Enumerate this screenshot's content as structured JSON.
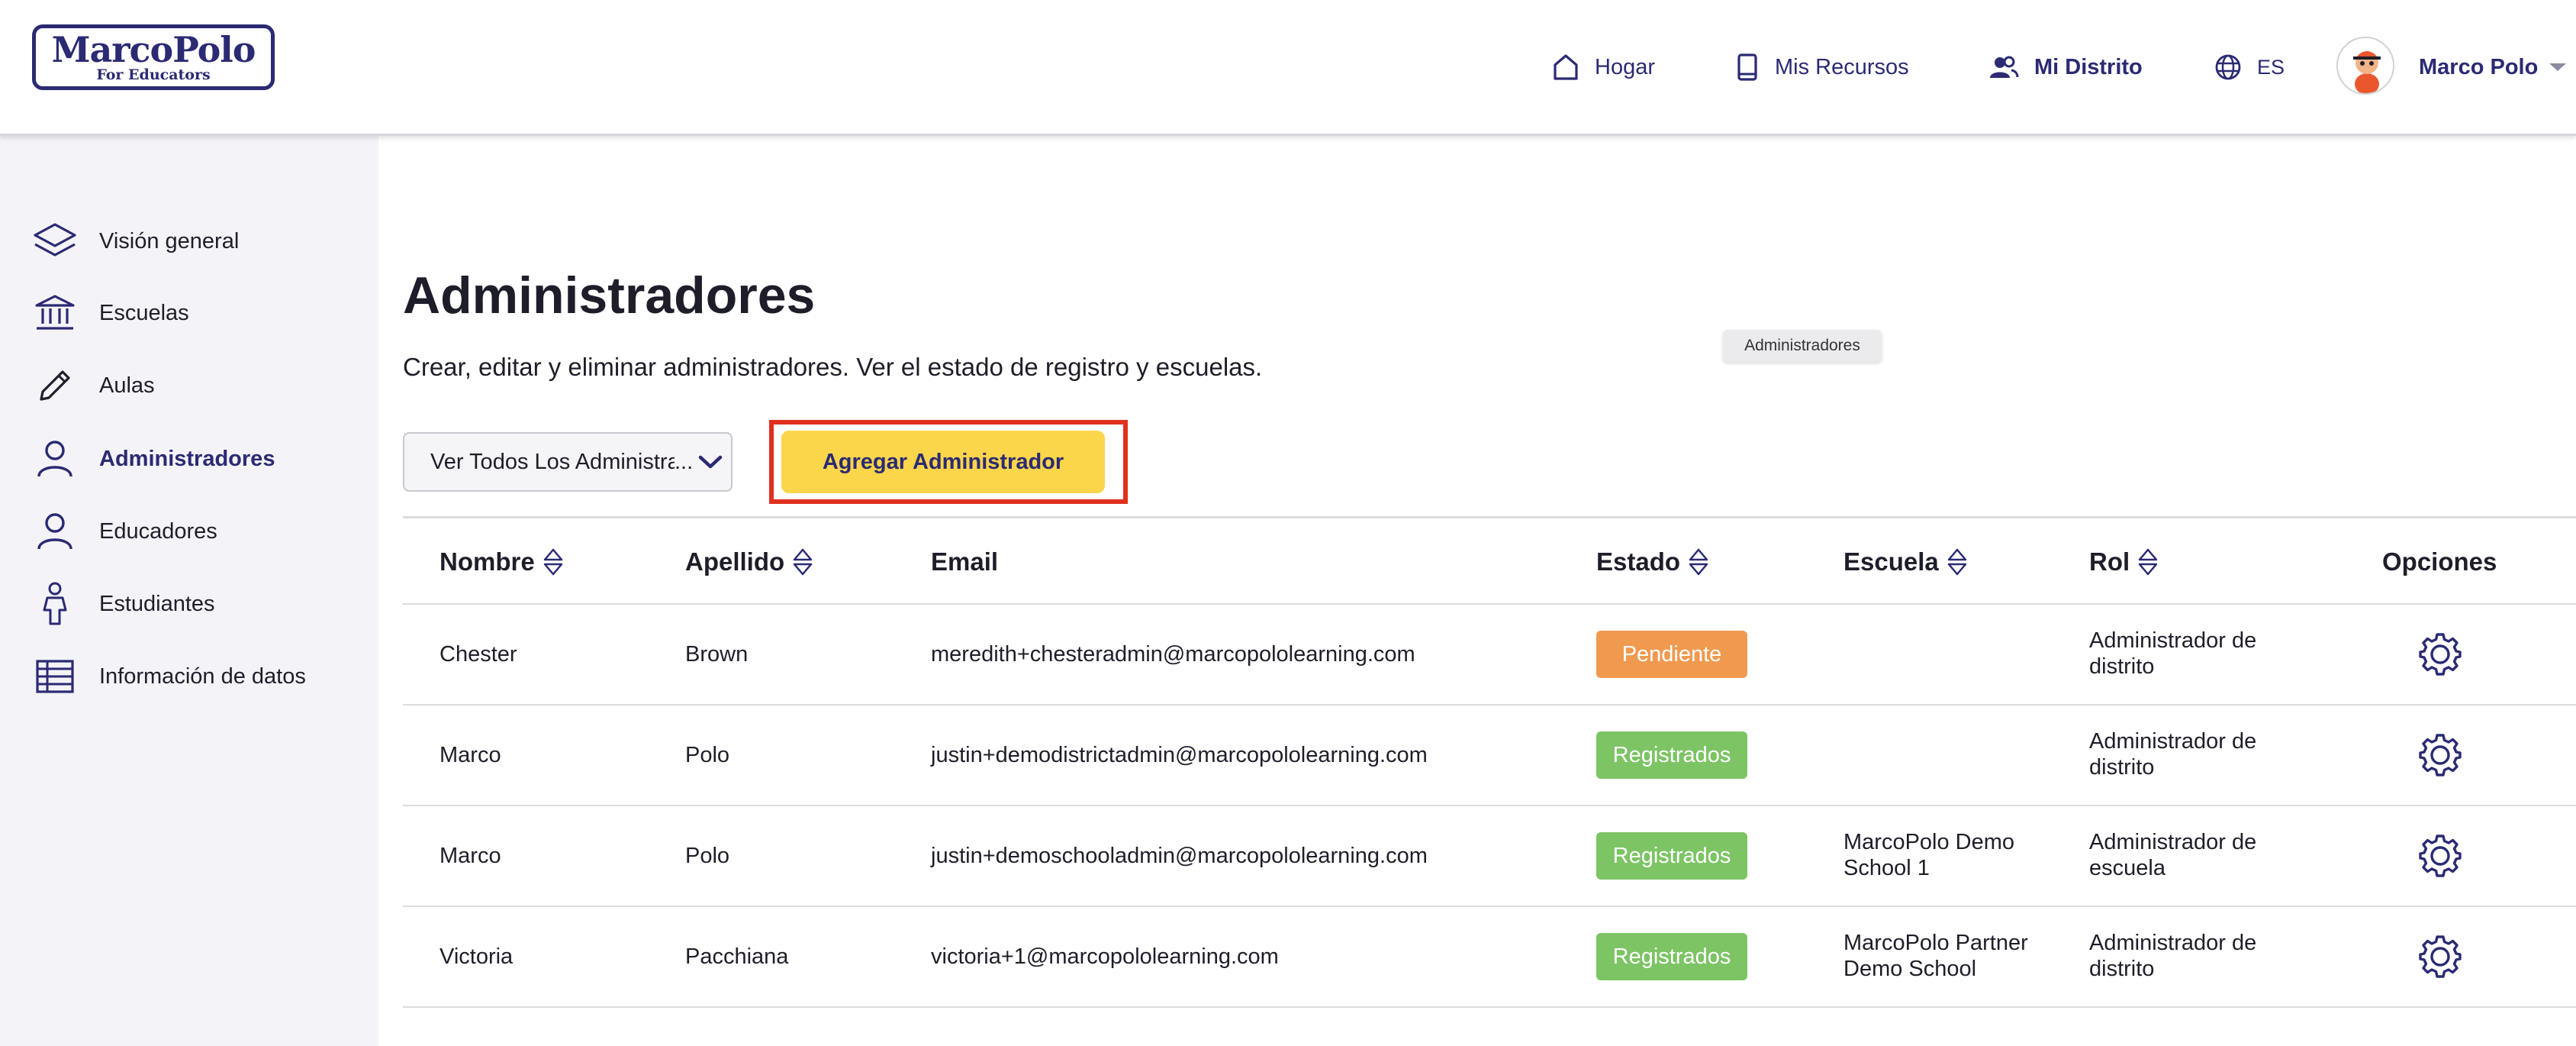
{
  "brand": {
    "name": "MarcoPolo",
    "tagline": "For Educators"
  },
  "nav": {
    "home": "Hogar",
    "resources": "Mis Recursos",
    "district": "Mi Distrito",
    "language": "ES",
    "user": "Marco Polo"
  },
  "sidebar": {
    "items": [
      {
        "label": "Visión general",
        "icon": "layers-icon"
      },
      {
        "label": "Escuelas",
        "icon": "bank-icon"
      },
      {
        "label": "Aulas",
        "icon": "pencil-icon"
      },
      {
        "label": "Administradores",
        "icon": "user-icon",
        "active": true
      },
      {
        "label": "Educadores",
        "icon": "user-icon"
      },
      {
        "label": "Estudiantes",
        "icon": "student-icon"
      },
      {
        "label": "Información de datos",
        "icon": "table-icon"
      }
    ]
  },
  "main": {
    "title": "Administradores",
    "subtitle": "Crear, editar y eliminar administradores. Ver el estado de registro y escuelas.",
    "tooltip": "Administradores",
    "filter_value": "Ver Todos Los Administradores",
    "add_button": "Agregar Administrador"
  },
  "table": {
    "headers": {
      "first_name": "Nombre",
      "last_name": "Apellido",
      "email": "Email",
      "status": "Estado",
      "school": "Escuela",
      "role": "Rol",
      "options": "Opciones"
    },
    "rows": [
      {
        "first_name": "Chester",
        "last_name": "Brown",
        "email": "meredith+chesteradmin@marcopololearning.com",
        "status": "Pendiente",
        "status_type": "pending",
        "school_1": "",
        "school_2": "",
        "role_1": "Administrador de",
        "role_2": "distrito"
      },
      {
        "first_name": "Marco",
        "last_name": "Polo",
        "email": "justin+demodistrictadmin@marcopololearning.com",
        "status": "Registrados",
        "status_type": "registered",
        "school_1": "",
        "school_2": "",
        "role_1": "Administrador de",
        "role_2": "distrito"
      },
      {
        "first_name": "Marco",
        "last_name": "Polo",
        "email": "justin+demoschooladmin@marcopololearning.com",
        "status": "Registrados",
        "status_type": "registered",
        "school_1": "MarcoPolo Demo",
        "school_2": "School 1",
        "role_1": "Administrador de",
        "role_2": "escuela"
      },
      {
        "first_name": "Victoria",
        "last_name": "Pacchiana",
        "email": "victoria+1@marcopololearning.com",
        "status": "Registrados",
        "status_type": "registered",
        "school_1": "MarcoPolo Partner",
        "school_2": "Demo School",
        "role_1": "Administrador de",
        "role_2": "distrito"
      }
    ]
  },
  "colors": {
    "brand": "#2b2a73",
    "accent": "#fbd54a",
    "pending": "#f09a50",
    "registered": "#7cc464",
    "highlight": "#e0301e"
  }
}
